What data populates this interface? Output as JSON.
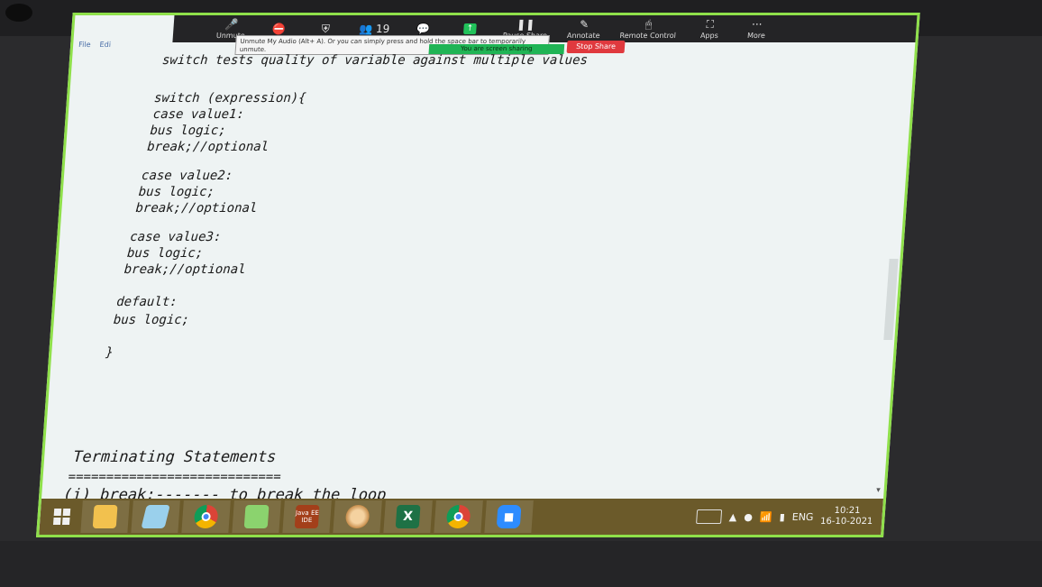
{
  "zoom_toolbar": {
    "unmute_label": "Unmute",
    "participants_count": "19",
    "pause_share": "Pause Share",
    "annotate": "Annotate",
    "remote_control": "Remote Control",
    "apps": "Apps",
    "more": "More",
    "tooltip": "Unmute My Audio (Alt+ A). Or you can simply press and hold the space bar to temporarily unmute.",
    "sharing_banner": "You are screen sharing",
    "stop_share": "Stop Share"
  },
  "menu": {
    "file": "File",
    "edit": "Edi"
  },
  "document": {
    "l1": "switch tests quality of variable against multiple values",
    "l2": "switch (expression){",
    "l3": "case value1:",
    "l4": "bus logic;",
    "l5": "break;//optional",
    "l6": "case value2:",
    "l7": "bus logic;",
    "l8": "break;//optional",
    "l9": "case value3:",
    "l10": "bus logic;",
    "l11": "break;//optional",
    "l12": "default:",
    "l13": "bus logic;",
    "l14": "}",
    "l15": "Terminating Statements",
    "l16": "============================",
    "l17": "(i) break;------- to break the loop"
  },
  "taskbar": {
    "javaee_label": "Java EE IDE",
    "excel_letter": "X",
    "language": "ENG",
    "time": "10:21",
    "date": "16-10-2021"
  },
  "icons": [
    "windows-start-icon",
    "file-explorer-icon",
    "notepad-icon",
    "chrome-icon",
    "sticky-notes-icon",
    "java-ee-icon",
    "paint-icon",
    "excel-icon",
    "zoom-icon"
  ]
}
